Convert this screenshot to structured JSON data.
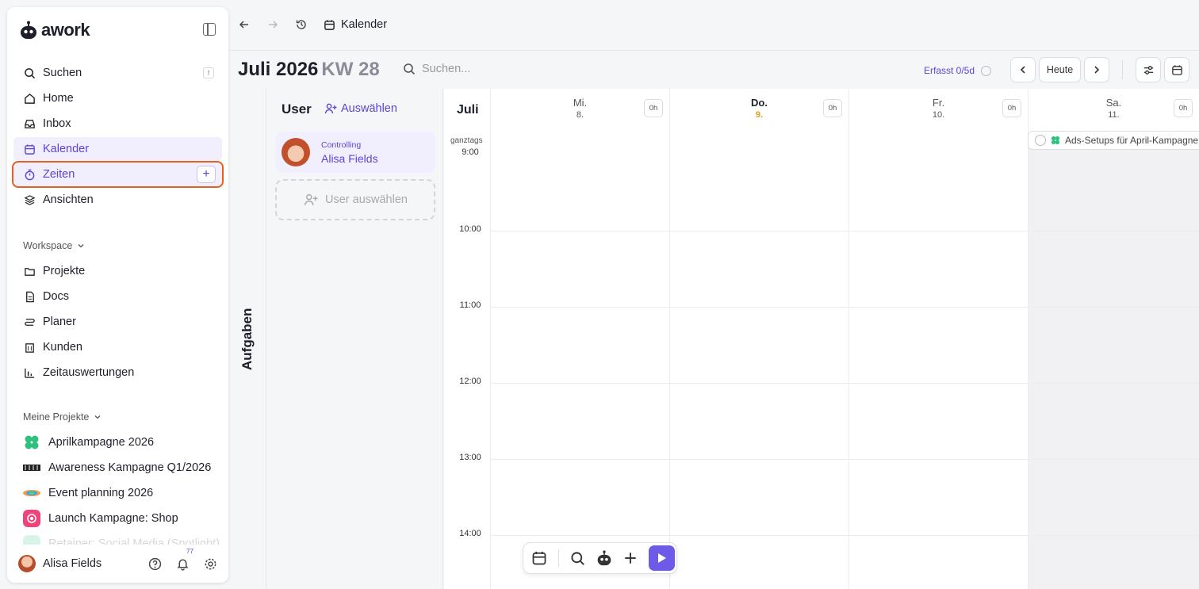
{
  "app": {
    "name": "awork"
  },
  "sidebar": {
    "nav": [
      {
        "label": "Suchen",
        "shortcut": "f"
      },
      {
        "label": "Home"
      },
      {
        "label": "Inbox"
      },
      {
        "label": "Kalender"
      },
      {
        "label": "Zeiten"
      },
      {
        "label": "Ansichten"
      }
    ],
    "workspace_label": "Workspace",
    "workspace": [
      {
        "label": "Projekte"
      },
      {
        "label": "Docs"
      },
      {
        "label": "Planer"
      },
      {
        "label": "Kunden"
      },
      {
        "label": "Zeitauswertungen"
      }
    ],
    "projects_label": "Meine Projekte",
    "projects": [
      {
        "label": "Aprilkampagne 2026",
        "color": "#2ec27e"
      },
      {
        "label": "Awareness Kampagne Q1/2026",
        "color": "#222222"
      },
      {
        "label": "Event planning 2026",
        "color": "#ff5a5a"
      },
      {
        "label": "Launch Kampagne: Shop",
        "color": "#f0437a"
      },
      {
        "label": "Retainer: Social Media (Spotlight)",
        "color": "#2ec27e"
      }
    ],
    "user": {
      "name": "Alisa Fields",
      "notifications": "77"
    }
  },
  "topbar": {
    "breadcrumb": "Kalender"
  },
  "calendar": {
    "month": "Juli 2026",
    "week": "KW 28",
    "search_placeholder": "Suchen...",
    "erfasst": "Erfasst 0/5d",
    "today_button": "Heute",
    "side_label": "Aufgaben",
    "user_header": "User",
    "select_link": "Auswählen",
    "selected_user": {
      "role": "Controlling",
      "name": "Alisa Fields"
    },
    "user_select_placeholder": "User auswählen",
    "month_short": "Juli",
    "allday_label": "ganztags",
    "days": [
      {
        "name": "Mi.",
        "date": "8.",
        "hours": "0h"
      },
      {
        "name": "Do.",
        "date": "9.",
        "hours": "0h",
        "today": true
      },
      {
        "name": "Fr.",
        "date": "10.",
        "hours": "0h"
      },
      {
        "name": "Sa.",
        "date": "11.",
        "hours": "0h"
      }
    ],
    "times": [
      "9:00",
      "10:00",
      "11:00",
      "12:00",
      "13:00",
      "14:00"
    ],
    "event": {
      "title": "Ads-Setups für April-Kampagne",
      "color": "#2ec27e"
    },
    "accent": "#5a45d8",
    "highlight": "#e0621d"
  }
}
